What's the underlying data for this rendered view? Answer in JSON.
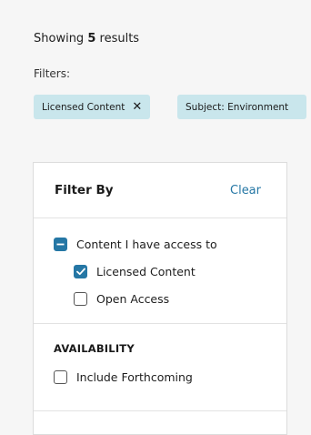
{
  "results": {
    "prefix": "Showing",
    "count": "5",
    "suffix": "results"
  },
  "filters": {
    "label": "Filters:",
    "chips": [
      {
        "label": "Licensed Content",
        "remove": "✕"
      },
      {
        "label": "Subject: Environment"
      }
    ]
  },
  "panel": {
    "title": "Filter By",
    "clear_label": "Clear",
    "access": {
      "parent_label": "Content I have access to",
      "parent_state": "indeterminate",
      "options": [
        {
          "label": "Licensed Content",
          "checked": true
        },
        {
          "label": "Open Access",
          "checked": false
        }
      ]
    },
    "availability": {
      "heading": "AVAILABILITY",
      "options": [
        {
          "label": "Include Forthcoming",
          "checked": false
        }
      ]
    }
  },
  "colors": {
    "accent": "#2577a5",
    "chip_bg": "#c9e6ec",
    "page_bg": "#f6f6f6"
  },
  "icons": {
    "chip_remove": "close-icon",
    "indeterminate": "minus-icon",
    "checked": "checkmark-icon"
  }
}
